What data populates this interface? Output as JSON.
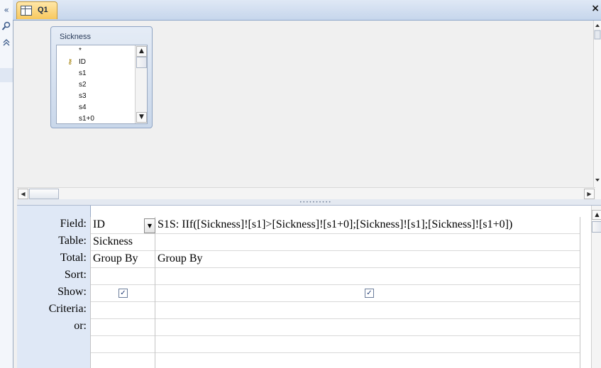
{
  "nav": {
    "collapse_icon": "«",
    "search_icon": "search-icon",
    "expand_icon": "up-chevrons-icon"
  },
  "tab": {
    "label": "Q1",
    "close": "×"
  },
  "table_window": {
    "title": "Sickness",
    "fields": [
      "*",
      "ID",
      "s1",
      "s2",
      "s3",
      "s4",
      "s1+0"
    ]
  },
  "grid": {
    "row_labels": [
      "Field:",
      "Table:",
      "Total:",
      "Sort:",
      "Show:",
      "Criteria:",
      "or:"
    ],
    "columns": [
      {
        "field": "ID",
        "table": "Sickness",
        "total": "Group By",
        "sort": "",
        "show": true,
        "criteria": "",
        "or": ""
      },
      {
        "field": "S1S: IIf([Sickness]![s1]>[Sickness]![s1+0];[Sickness]![s1];[Sickness]![s1+0])",
        "table": "",
        "total": "Group By",
        "sort": "",
        "show": true,
        "criteria": "",
        "or": ""
      }
    ]
  },
  "colors": {
    "tab_active": "#f7c85e",
    "label_bg": "#dfe8f6",
    "border": "#8ea7c9"
  }
}
